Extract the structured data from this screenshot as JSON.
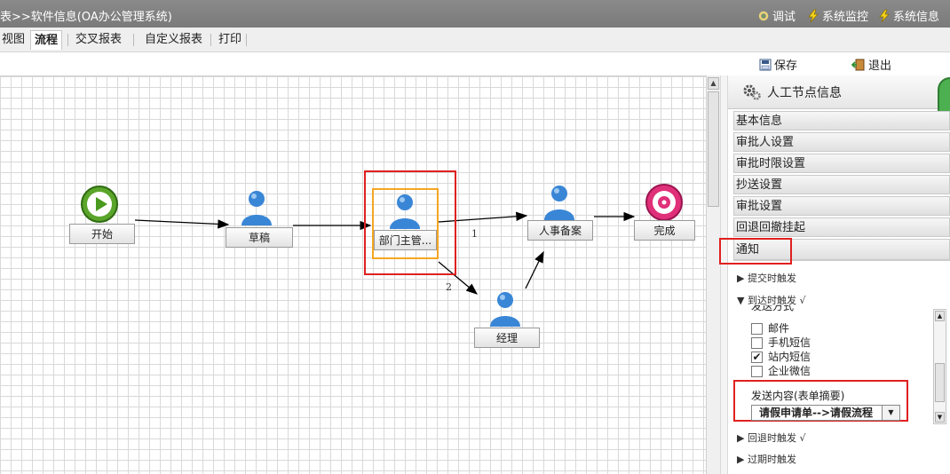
{
  "window": {
    "title": "表>>软件信息(OA办公管理系统)",
    "links": [
      {
        "label": "调试",
        "icon": "debug-gear-icon"
      },
      {
        "label": "系统监控",
        "icon": "lightning-icon"
      },
      {
        "label": "系统信息",
        "icon": "lightning-icon"
      }
    ]
  },
  "tabs": [
    {
      "label": "视图"
    },
    {
      "label": "流程",
      "active": true
    },
    {
      "label": "交叉报表"
    },
    {
      "label": "自定义报表"
    },
    {
      "label": "打印"
    }
  ],
  "toolbar": {
    "save_label": "保存",
    "exit_label": "退出"
  },
  "flow": {
    "nodes": {
      "start": "开始",
      "draft": "草稿",
      "dept": "部门主管...",
      "hr": "人事备案",
      "end": "完成",
      "manager": "经理"
    },
    "edge_labels": {
      "e1": "1",
      "e2": "2"
    }
  },
  "panel": {
    "title": "人工节点信息",
    "sections": [
      "基本信息",
      "审批人设置",
      "审批时限设置",
      "抄送设置",
      "审批设置",
      "回退回撤挂起",
      "通知"
    ],
    "triggers": {
      "submit": "▶ 提交时触发",
      "arrive": "▼ 到达时触发 √",
      "back": "▶ 回退时触发 √",
      "expire": "▶ 过期时触发"
    },
    "send_method_label": "发送方式",
    "options": [
      {
        "label": "邮件",
        "checked": false
      },
      {
        "label": "手机短信",
        "checked": false
      },
      {
        "label": "站内短信",
        "checked": true
      },
      {
        "label": "企业微信",
        "checked": false
      }
    ],
    "content_label": "发送内容(表单摘要)",
    "content_value": "请假申请单-->请假流程"
  },
  "colors": {
    "highlight_red": "#e02020",
    "selected_orange": "#f5a623"
  }
}
